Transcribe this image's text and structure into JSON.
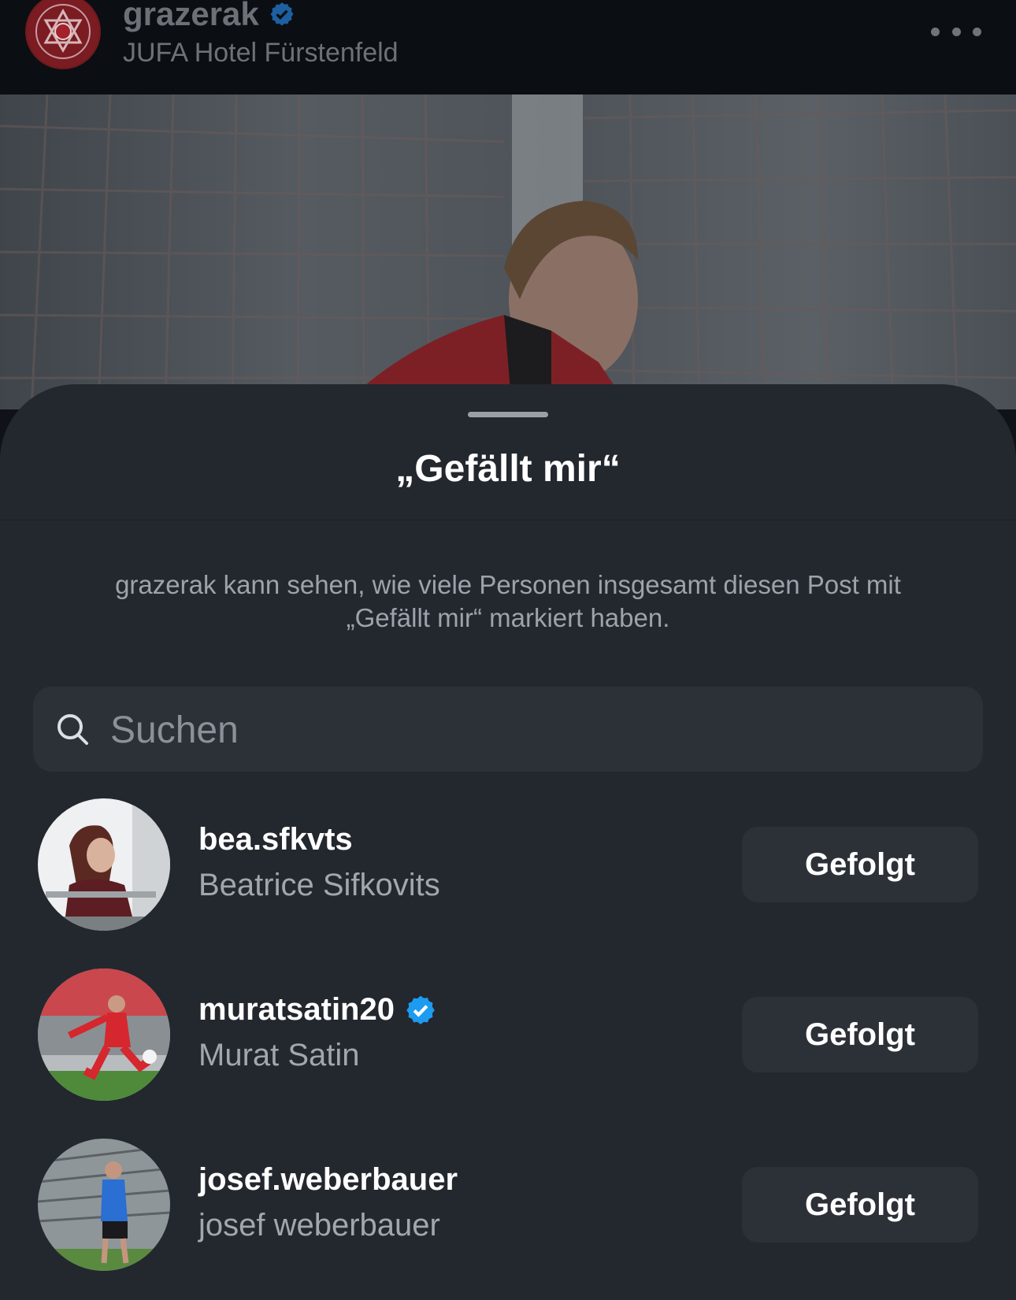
{
  "post_header": {
    "username": "grazerak",
    "location": "JUFA Hotel Fürstenfeld",
    "verified": true
  },
  "sheet": {
    "title": "„Gefällt mir“",
    "info": "grazerak kann sehen, wie viele Personen insgesamt diesen Post mit „Gefällt mir“ markiert haben.",
    "search_placeholder": "Suchen"
  },
  "likes": [
    {
      "username": "bea.sfkvts",
      "full_name": "Beatrice Sifkovits",
      "verified": false,
      "button_label": "Gefolgt"
    },
    {
      "username": "muratsatin20",
      "full_name": "Murat Satin",
      "verified": true,
      "button_label": "Gefolgt"
    },
    {
      "username": "josef.weberbauer",
      "full_name": "josef weberbauer",
      "verified": false,
      "button_label": "Gefolgt"
    }
  ],
  "colors": {
    "sheet_background": "#23272e",
    "button_background": "#2c3138",
    "verified_blue": "#1d9bf0",
    "club_red": "#a3212a"
  }
}
